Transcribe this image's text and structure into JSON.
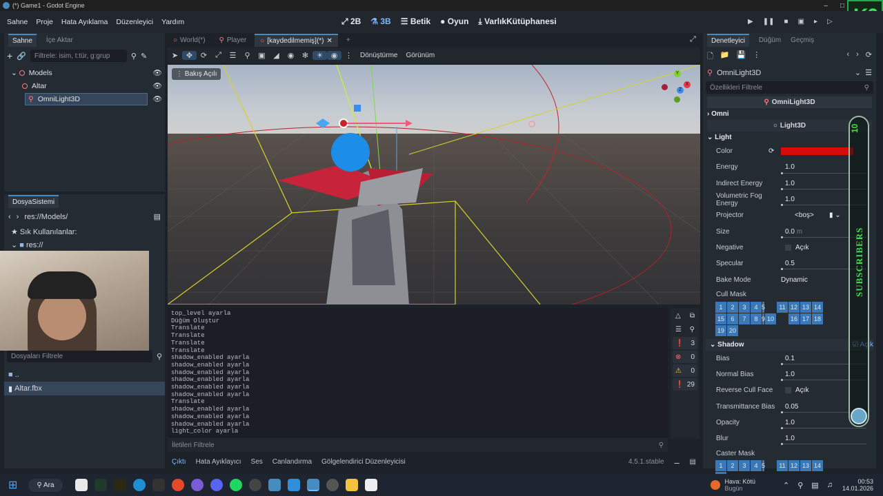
{
  "window": {
    "title": "(*) Game1 - Godot Engine"
  },
  "menu": [
    "Sahne",
    "Proje",
    "Hata Ayıklama",
    "Düzenleyici",
    "Yardım"
  ],
  "main_screens": {
    "two_d": "2B",
    "three_d": "3B",
    "script": "Betik",
    "game": "Oyun",
    "asset_lib": "VarlıkKütüphanesi"
  },
  "brand_badge": "K6",
  "scene_dock": {
    "tabs": [
      "Sahne",
      "İçe Aktar"
    ],
    "filter_placeholder": "Filtrele: isim, t:tür, g:grup",
    "nodes": [
      "Models",
      "Altar",
      "OmniLight3D"
    ]
  },
  "fs_dock": {
    "title": "DosyaSistemi",
    "path": "res://Models/",
    "favorites": "Sık Kullanılanlar:",
    "root": "res://",
    "filter_placeholder": "Dosyaları Filtrele",
    "items": [
      "..",
      "Altar.fbx"
    ]
  },
  "editor_tabs": [
    "World(*)",
    "Player",
    "[kaydedilmemiş](*)"
  ],
  "toolbar3d": {
    "transform": "Dönüştürme",
    "view": "Görünüm"
  },
  "viewport": {
    "perspective_label": "Bakış Açılı",
    "gizmo_axes": [
      "Y",
      "X",
      "Z"
    ]
  },
  "log_lines": [
    "top_level ayarla",
    "Düğüm Oluştur",
    "Translate",
    "Translate",
    "Translate",
    "Translate",
    "shadow_enabled ayarla",
    "shadow_enabled ayarla",
    "shadow_enabled ayarla",
    "shadow_enabled ayarla",
    "shadow_enabled ayarla",
    "shadow_enabled ayarla",
    "Translate",
    "shadow_enabled ayarla",
    "shadow_enabled ayarla",
    "shadow_enabled ayarla",
    "light_color ayarla"
  ],
  "log_counts": {
    "messages": "3",
    "errors": "0",
    "warnings": "0",
    "editor": "29"
  },
  "log_filter_placeholder": "İletileri Filtrele",
  "bottom_tabs": [
    "Çıktı",
    "Hata Ayıklayıcı",
    "Ses",
    "Canlandırma",
    "Gölgelendirici Düzenleyicisi"
  ],
  "version": "4.5.1.stable",
  "inspector": {
    "tabs": [
      "Denetleyici",
      "Düğüm",
      "Geçmiş"
    ],
    "node_name": "OmniLight3D",
    "filter_placeholder": "Özellikleri Filtrele",
    "class_name": "OmniLight3D",
    "sections": {
      "omni": "Omni",
      "light3d": "Light3D",
      "light": "Light",
      "shadow": "Shadow"
    },
    "color_value": "#d90a0a",
    "light_props": [
      {
        "name": "Color",
        "value": ""
      },
      {
        "name": "Energy",
        "value": "1.0"
      },
      {
        "name": "Indirect Energy",
        "value": "1.0"
      },
      {
        "name": "Volumetric Fog Energy",
        "value": "1.0"
      },
      {
        "name": "Projector",
        "value": "<boş>"
      },
      {
        "name": "Size",
        "value": "0.0",
        "unit": "m"
      },
      {
        "name": "Negative",
        "value": "Açık"
      },
      {
        "name": "Specular",
        "value": "0.5"
      },
      {
        "name": "Bake Mode",
        "value": "Dynamic"
      }
    ],
    "cull_mask_label": "Cull Mask",
    "mask_row1": [
      "1",
      "2",
      "3",
      "4",
      "5",
      "11",
      "12",
      "13",
      "14",
      "15"
    ],
    "mask_row2": [
      "6",
      "7",
      "8",
      "9",
      "10",
      "16",
      "17",
      "18",
      "19",
      "20"
    ],
    "shadow_on": "Açık",
    "shadow_props": [
      {
        "name": "Bias",
        "value": "0.1"
      },
      {
        "name": "Normal Bias",
        "value": "1.0"
      },
      {
        "name": "Reverse Cull Face",
        "value": "Açık"
      },
      {
        "name": "Transmittance Bias",
        "value": "0.05"
      },
      {
        "name": "Opacity",
        "value": "1.0"
      },
      {
        "name": "Blur",
        "value": "1.0"
      }
    ],
    "caster_mask_label": "Caster Mask"
  },
  "overlay": {
    "subscribers": "SUBSCRIBERS",
    "count": "10"
  },
  "taskbar": {
    "search": "Ara",
    "weather_line1": "Hava: Kötü",
    "weather_line2": "Bugün",
    "time": "00:53",
    "date": "14.01.2026"
  }
}
